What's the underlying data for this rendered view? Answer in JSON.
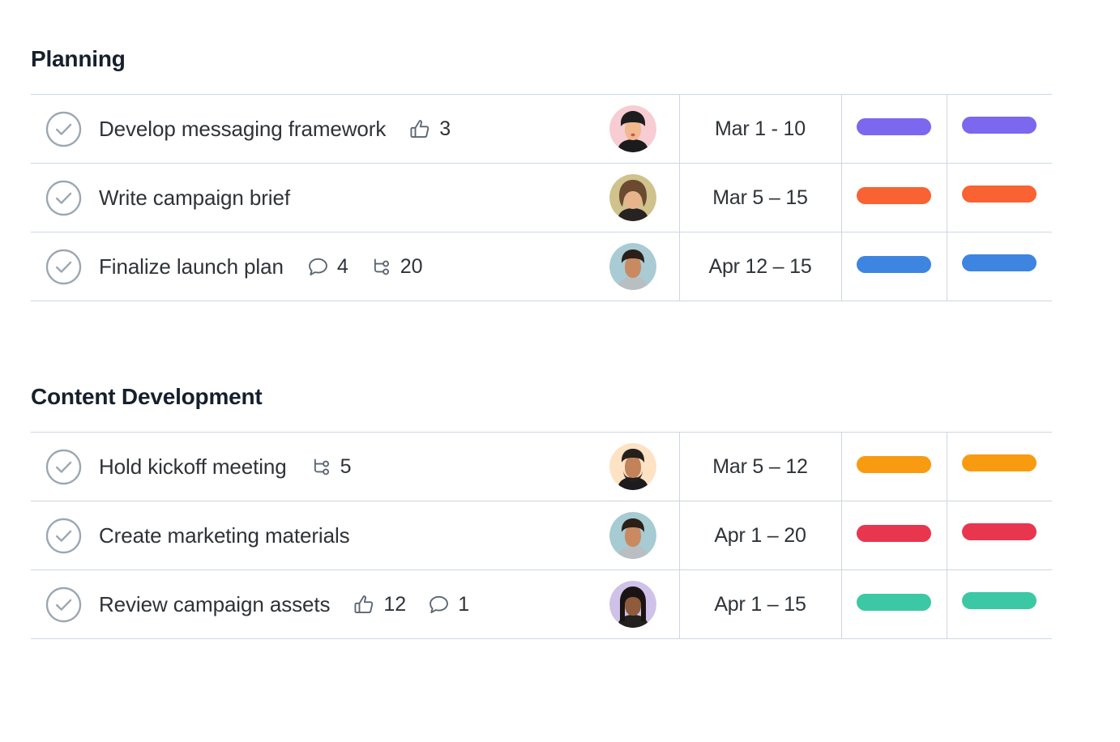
{
  "sections": [
    {
      "title": "Planning",
      "rows": [
        {
          "status_icon": "check-circle-icon",
          "task": "Develop messaging framework",
          "meta": [
            {
              "icon": "thumbs-up-icon",
              "count": "3"
            }
          ],
          "avatar": {
            "name": "assignee-avatar",
            "bg": "#f7ccd2",
            "skin": "#f0b98e",
            "hair": "#1d1d1f",
            "shirt": "#1b1b1d",
            "style": "short-hair-woman"
          },
          "date": "Mar 1 - 10",
          "tag_a_color": "#7b68ee",
          "tag_b_color": "#7b68ee"
        },
        {
          "status_icon": "check-circle-icon",
          "task": "Write campaign brief",
          "meta": [],
          "avatar": {
            "name": "assignee-avatar",
            "bg": "#cfc28c",
            "skin": "#e8b48c",
            "hair": "#6b4a2f",
            "shirt": "#262322",
            "style": "curly-hair-woman"
          },
          "date": "Mar 5 – 15",
          "tag_a_color": "#f96232",
          "tag_b_color": "#f96232"
        },
        {
          "status_icon": "check-circle-icon",
          "task": "Finalize launch plan",
          "meta": [
            {
              "icon": "comment-icon",
              "count": "4"
            },
            {
              "icon": "subtask-icon",
              "count": "20"
            }
          ],
          "avatar": {
            "name": "assignee-avatar",
            "bg": "#a9cbd4",
            "skin": "#c98a61",
            "hair": "#2a2018",
            "shirt": "#b9bec2",
            "style": "short-hair-man"
          },
          "date": "Apr 12 – 15",
          "tag_a_color": "#3d85e0",
          "tag_b_color": "#3d85e0"
        }
      ]
    },
    {
      "title": "Content Development",
      "rows": [
        {
          "status_icon": "check-circle-icon",
          "task": "Hold kickoff meeting",
          "meta": [
            {
              "icon": "subtask-icon",
              "count": "5"
            }
          ],
          "avatar": {
            "name": "assignee-avatar",
            "bg": "#fde2c4",
            "skin": "#c2825a",
            "hair": "#26201c",
            "shirt": "#1c1c1e",
            "style": "bearded-man"
          },
          "date": "Mar 5 – 12",
          "tag_a_color": "#f89b11",
          "tag_b_color": "#f89b11"
        },
        {
          "status_icon": "check-circle-icon",
          "task": "Create marketing materials",
          "meta": [],
          "avatar": {
            "name": "assignee-avatar",
            "bg": "#a6cbd2",
            "skin": "#c98a61",
            "hair": "#2a2018",
            "shirt": "#b9bec2",
            "style": "short-hair-man"
          },
          "date": "Apr 1 – 20",
          "tag_a_color": "#e9364f",
          "tag_b_color": "#e9364f"
        },
        {
          "status_icon": "check-circle-icon",
          "task": "Review campaign assets",
          "meta": [
            {
              "icon": "thumbs-up-icon",
              "count": "12"
            },
            {
              "icon": "comment-icon",
              "count": "1"
            }
          ],
          "avatar": {
            "name": "assignee-avatar",
            "bg": "#cfc1e8",
            "skin": "#8e5b3c",
            "hair": "#191413",
            "shirt": "#23201f",
            "style": "long-hair-woman"
          },
          "date": "Apr 1 – 15",
          "tag_a_color": "#3cc8a4",
          "tag_b_color": "#3cc8a4"
        }
      ]
    }
  ],
  "colors": {
    "grid_line": "#cdd7e0",
    "status_icon": "#9aa6b2",
    "meta_icon": "#5b6671",
    "text": "#2e3338",
    "heading": "#16202c",
    "background": "#ffffff"
  }
}
